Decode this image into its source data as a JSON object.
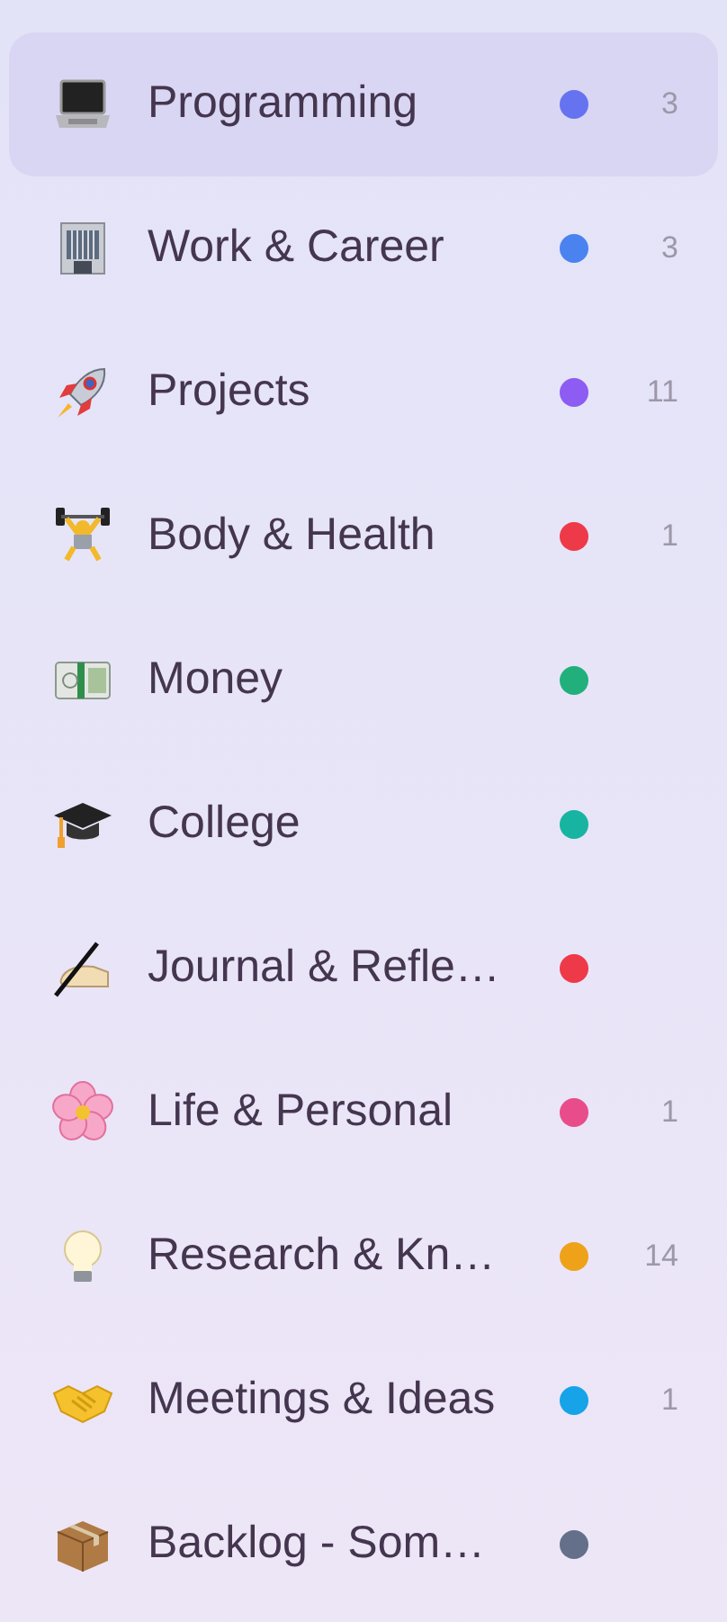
{
  "sidebar": {
    "items": [
      {
        "label": "Programming",
        "color": "#6673f0",
        "count": "3",
        "selected": true
      },
      {
        "label": "Work & Career",
        "color": "#4a82f0",
        "count": "3",
        "selected": false
      },
      {
        "label": "Projects",
        "color": "#8d5cf2",
        "count": "11",
        "selected": false
      },
      {
        "label": "Body & Health",
        "color": "#ee3a48",
        "count": "1",
        "selected": false
      },
      {
        "label": "Money",
        "color": "#21b07c",
        "selected": false
      },
      {
        "label": "College",
        "color": "#17b4a2",
        "selected": false
      },
      {
        "label": "Journal & Refle…",
        "color": "#ee3a48",
        "selected": false
      },
      {
        "label": "Life & Personal",
        "color": "#e84c8b",
        "count": "1",
        "selected": false
      },
      {
        "label": "Research & Kn…",
        "color": "#eda21a",
        "count": "14",
        "selected": false
      },
      {
        "label": "Meetings & Ideas",
        "color": "#16a3e8",
        "count": "1",
        "selected": false
      },
      {
        "label": "Backlog - Som…",
        "color": "#647089",
        "selected": false
      }
    ]
  }
}
